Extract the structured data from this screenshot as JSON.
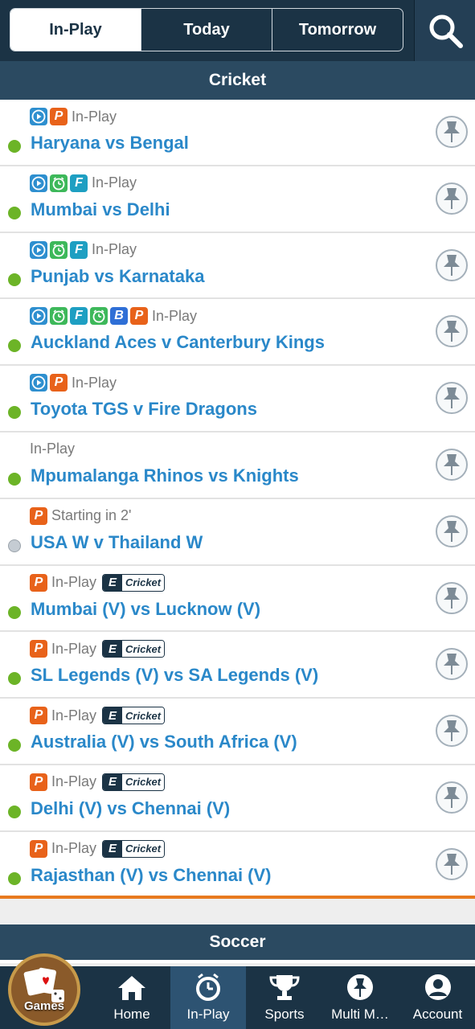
{
  "tabs": [
    "In-Play",
    "Today",
    "Tomorrow"
  ],
  "section_cricket": "Cricket",
  "section_soccer": "Soccer",
  "matches": [
    {
      "badges": [
        "play",
        "p"
      ],
      "status": "In-Play",
      "title": "Haryana vs Bengal",
      "live": true,
      "ecricket": false
    },
    {
      "badges": [
        "play",
        "clock",
        "f"
      ],
      "status": "In-Play",
      "title": "Mumbai vs Delhi",
      "live": true,
      "ecricket": false
    },
    {
      "badges": [
        "play",
        "clock",
        "f"
      ],
      "status": "In-Play",
      "title": "Punjab vs Karnataka",
      "live": true,
      "ecricket": false
    },
    {
      "badges": [
        "play",
        "clock",
        "f",
        "clock",
        "b",
        "p"
      ],
      "status": "In-Play",
      "title": "Auckland Aces v Canterbury Kings",
      "live": true,
      "ecricket": false
    },
    {
      "badges": [
        "play",
        "p"
      ],
      "status": "In-Play",
      "title": "Toyota TGS v Fire Dragons",
      "live": true,
      "ecricket": false
    },
    {
      "badges": [],
      "status": "In-Play",
      "title": "Mpumalanga Rhinos vs Knights",
      "live": true,
      "ecricket": false
    },
    {
      "badges": [
        "p"
      ],
      "status": "Starting in 2'",
      "title": "USA W v Thailand W",
      "live": false,
      "ecricket": false
    },
    {
      "badges": [
        "p"
      ],
      "status": "In-Play",
      "title": "Mumbai (V) vs Lucknow (V)",
      "live": true,
      "ecricket": true
    },
    {
      "badges": [
        "p"
      ],
      "status": "In-Play",
      "title": "SL Legends (V) vs SA Legends (V)",
      "live": true,
      "ecricket": true
    },
    {
      "badges": [
        "p"
      ],
      "status": "In-Play",
      "title": "Australia (V) vs South Africa (V)",
      "live": true,
      "ecricket": true
    },
    {
      "badges": [
        "p"
      ],
      "status": "In-Play",
      "title": "Delhi (V) vs Chennai (V)",
      "live": true,
      "ecricket": true
    },
    {
      "badges": [
        "p"
      ],
      "status": "In-Play",
      "title": "Rajasthan (V) vs Chennai (V)",
      "live": true,
      "ecricket": true
    }
  ],
  "ecricket_label": {
    "e": "E",
    "c": "Cricket"
  },
  "badge_letters": {
    "p": "P",
    "f": "F",
    "b": "B"
  },
  "games_label": "Games",
  "nav": [
    {
      "label": "Home",
      "icon": "home-icon"
    },
    {
      "label": "In-Play",
      "icon": "clock-icon"
    },
    {
      "label": "Sports",
      "icon": "trophy-icon"
    },
    {
      "label": "Multi M…",
      "icon": "pin-icon"
    },
    {
      "label": "Account",
      "icon": "account-icon"
    }
  ],
  "colors": {
    "header": "#1b3345",
    "accent_blue": "#2a88c9",
    "live_green": "#6cb427",
    "orange": "#e8621a"
  }
}
